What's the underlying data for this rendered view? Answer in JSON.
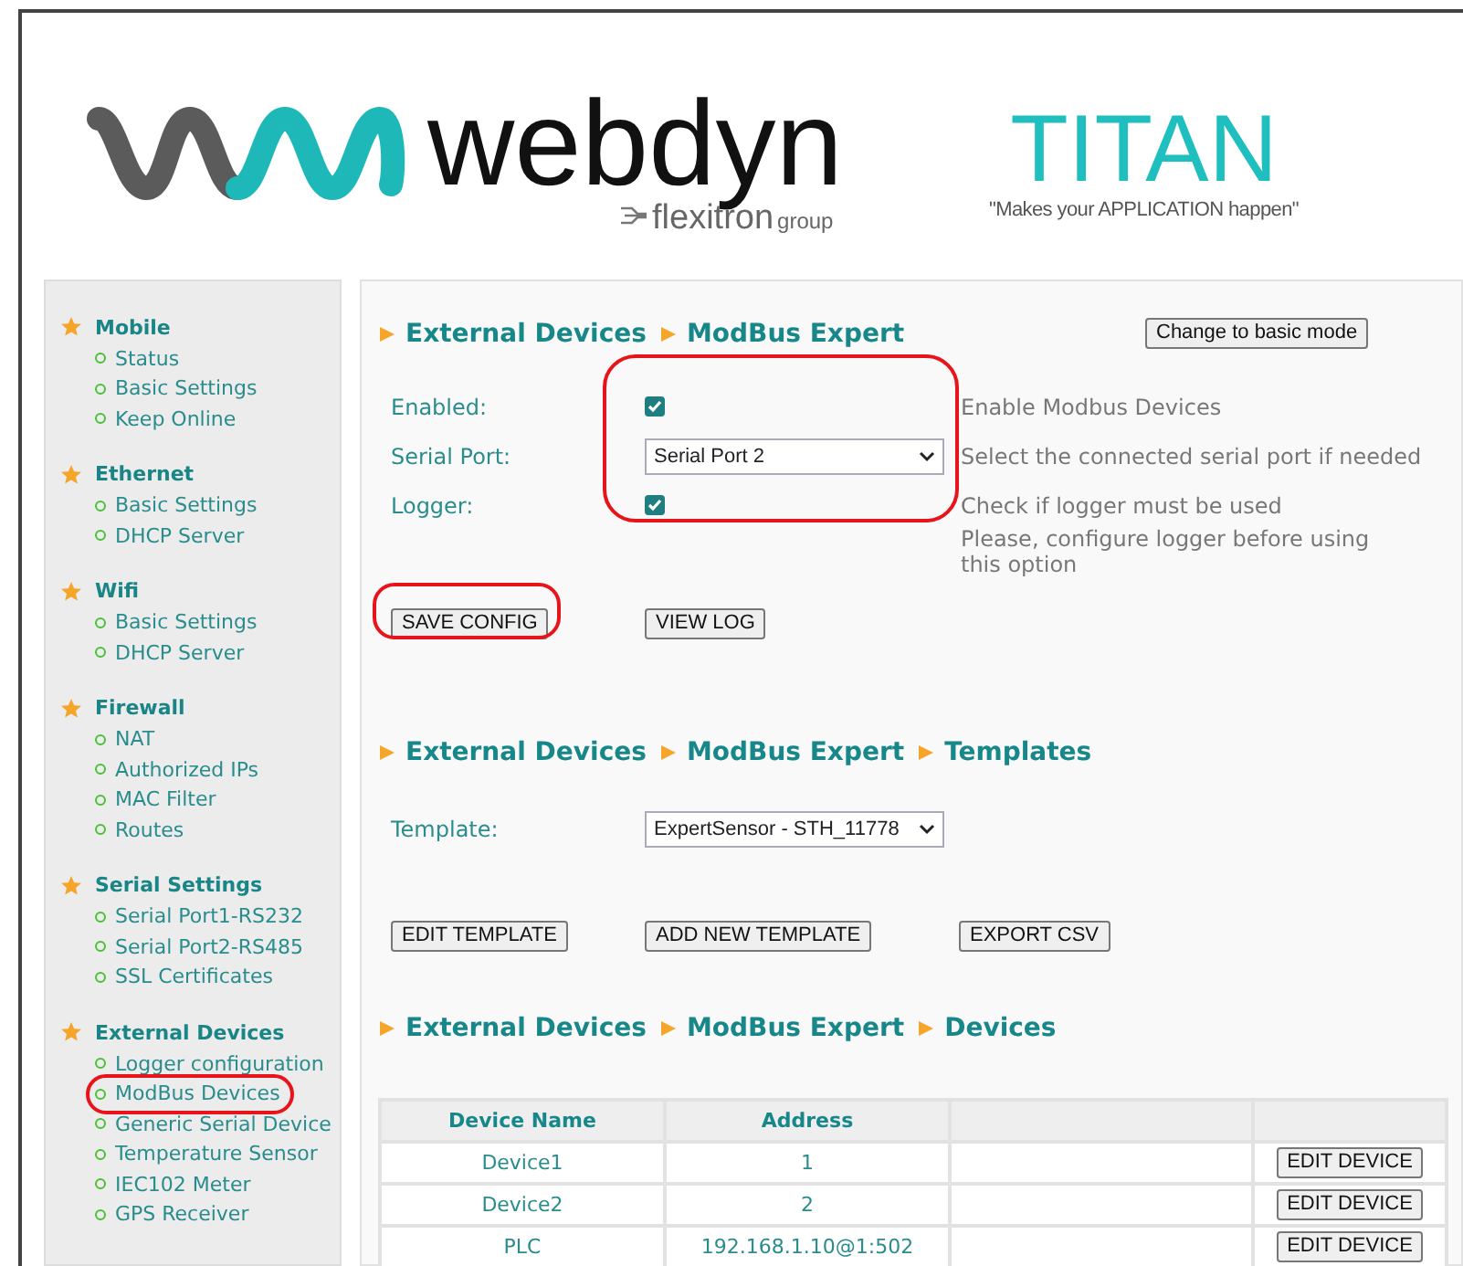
{
  "header": {
    "brand": "webdyn",
    "brand_sub": "flexitron",
    "brand_group": "group",
    "product": "TITAN",
    "tagline": "\"Makes your APPLICATION happen\""
  },
  "sidebar": [
    {
      "title": "Mobile",
      "items": [
        {
          "label": "Status",
          "highlighted": false
        },
        {
          "label": "Basic Settings",
          "highlighted": false
        },
        {
          "label": "Keep Online",
          "highlighted": false
        }
      ]
    },
    {
      "title": "Ethernet",
      "items": [
        {
          "label": "Basic Settings",
          "highlighted": false
        },
        {
          "label": "DHCP Server",
          "highlighted": false
        }
      ]
    },
    {
      "title": "Wifi",
      "items": [
        {
          "label": "Basic Settings",
          "highlighted": false
        },
        {
          "label": "DHCP Server",
          "highlighted": false
        }
      ]
    },
    {
      "title": "Firewall",
      "items": [
        {
          "label": "NAT",
          "highlighted": false
        },
        {
          "label": "Authorized IPs",
          "highlighted": false
        },
        {
          "label": "MAC Filter",
          "highlighted": false
        },
        {
          "label": "Routes",
          "highlighted": false
        }
      ]
    },
    {
      "title": "Serial Settings",
      "items": [
        {
          "label": "Serial Port1-RS232",
          "highlighted": false
        },
        {
          "label": "Serial Port2-RS485",
          "highlighted": false
        },
        {
          "label": "SSL Certificates",
          "highlighted": false
        }
      ]
    },
    {
      "title": "External Devices",
      "items": [
        {
          "label": "Logger configuration",
          "highlighted": false
        },
        {
          "label": "ModBus Devices",
          "highlighted": true
        },
        {
          "label": "Generic Serial Device",
          "highlighted": false
        },
        {
          "label": "Temperature Sensor",
          "highlighted": false
        },
        {
          "label": "IEC102 Meter",
          "highlighted": false
        },
        {
          "label": "GPS Receiver",
          "highlighted": false
        }
      ]
    }
  ],
  "config": {
    "breadcrumb": [
      "External Devices",
      "ModBus Expert"
    ],
    "mode_button": "Change to basic mode",
    "controls_highlighted": true,
    "fields": [
      {
        "kind": "checkbox",
        "label": "Enabled:",
        "checked": true,
        "hint": "Enable Modbus Devices"
      },
      {
        "kind": "select",
        "label": "Serial Port:",
        "value": "Serial Port 2",
        "hint": "Select the connected serial port if needed"
      },
      {
        "kind": "checkbox",
        "label": "Logger:",
        "checked": true,
        "hint": "Check if logger must be used"
      }
    ],
    "note": "Please, configure logger before using this option",
    "buttons": [
      {
        "label": "SAVE CONFIG",
        "highlighted": true
      },
      {
        "label": "VIEW LOG",
        "highlighted": false
      }
    ]
  },
  "templates": {
    "breadcrumb": [
      "External Devices",
      "ModBus Expert",
      "Templates"
    ],
    "label": "Template:",
    "value": "ExpertSensor - STH_11778",
    "buttons": [
      "EDIT TEMPLATE",
      "ADD NEW TEMPLATE",
      "EXPORT CSV"
    ]
  },
  "devices": {
    "breadcrumb": [
      "External Devices",
      "ModBus Expert",
      "Devices"
    ],
    "columns": [
      "Device Name",
      "Address"
    ],
    "rows": [
      {
        "name": "Device1",
        "address": "1",
        "button": "EDIT DEVICE"
      },
      {
        "name": "Device2",
        "address": "2",
        "button": "EDIT DEVICE"
      },
      {
        "name": "PLC",
        "address": "192.168.1.10@1:502",
        "button": "EDIT DEVICE"
      }
    ]
  }
}
